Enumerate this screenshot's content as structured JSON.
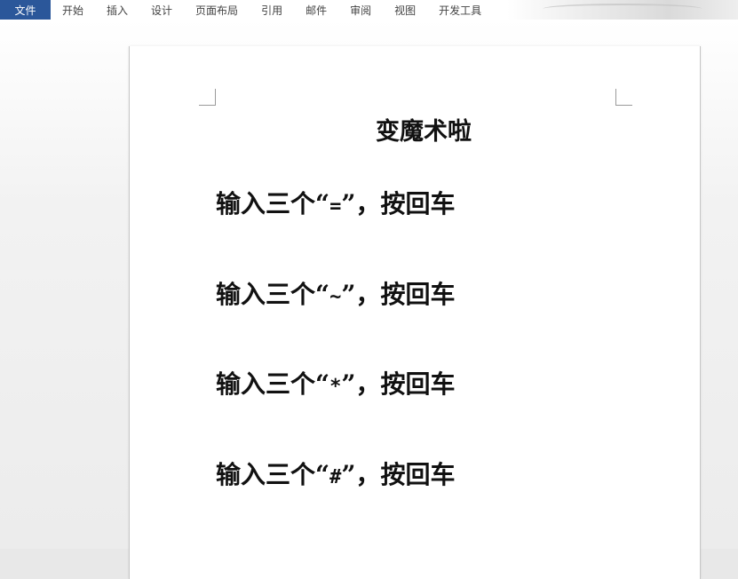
{
  "ribbon": {
    "tabs": [
      "文件",
      "开始",
      "插入",
      "设计",
      "页面布局",
      "引用",
      "邮件",
      "审阅",
      "视图",
      "开发工具"
    ]
  },
  "document": {
    "title": "变魔术啦",
    "lines": [
      {
        "prefix": "输入三个“",
        "symbol": "=",
        "suffix": "”，按回车"
      },
      {
        "prefix": "输入三个“",
        "symbol": "~",
        "suffix": "”，按回车"
      },
      {
        "prefix": "输入三个“",
        "symbol": "*",
        "suffix": "”，按回车"
      },
      {
        "prefix": "输入三个“",
        "symbol": "#",
        "suffix": "”，按回车"
      }
    ]
  }
}
